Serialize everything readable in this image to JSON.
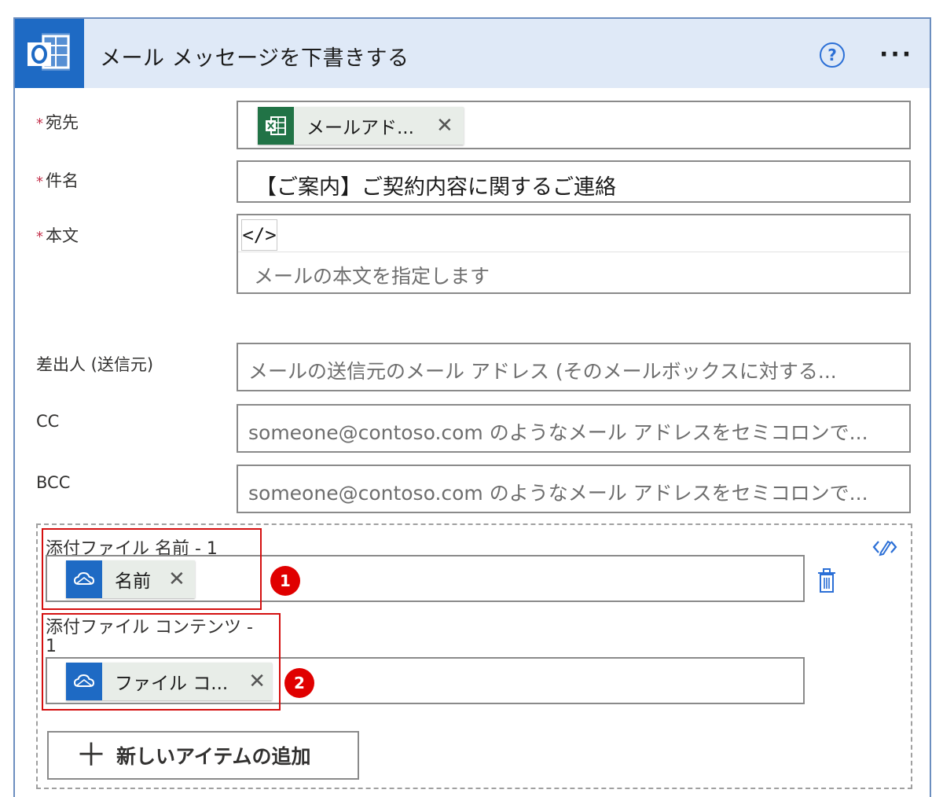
{
  "header": {
    "title": "メール メッセージを下書きする",
    "app_icon": "outlook-icon",
    "help_icon": "help-icon",
    "more_icon": "more-options-icon",
    "help_label": "?",
    "more_label": "···"
  },
  "fields": {
    "to": {
      "required_mark": "*",
      "label": "宛先",
      "token_label": "メールアド...",
      "token_icon": "excel-icon",
      "close_glyph": "✕"
    },
    "subject": {
      "required_mark": "*",
      "label": "件名",
      "value": "【ご案内】ご契約内容に関するご連絡"
    },
    "body": {
      "required_mark": "*",
      "label": "本文",
      "code_button": "</>",
      "placeholder": "メールの本文を指定します"
    },
    "from": {
      "label": "差出人 (送信元)",
      "placeholder": "メールの送信元のメール アドレス (そのメールボックスに対する..."
    },
    "cc": {
      "label": "CC",
      "placeholder": "someone@contoso.com のようなメール アドレスをセミコロンで..."
    },
    "bcc": {
      "label": "BCC",
      "placeholder": "someone@contoso.com のようなメール アドレスをセミコロンで..."
    }
  },
  "attachments": {
    "name_label": "添付ファイル 名前 - 1",
    "name_token": "名前",
    "content_label_line1": "添付ファイル コンテンツ -",
    "content_label_line2": "1",
    "content_token": "ファイル コ...",
    "token_icon": "onedrive-icon",
    "close_glyph": "✕",
    "add_button_label": "新しいアイテムの追加",
    "add_button_glyph": "＋",
    "badges": [
      "1",
      "2"
    ]
  },
  "colors": {
    "accent": "#1e6ac4",
    "header_bg": "#dfe9f7",
    "excel_green": "#217346",
    "onedrive_blue": "#1e6ac4",
    "required_red": "#c4314b",
    "annotation_red": "#d40f0f"
  }
}
